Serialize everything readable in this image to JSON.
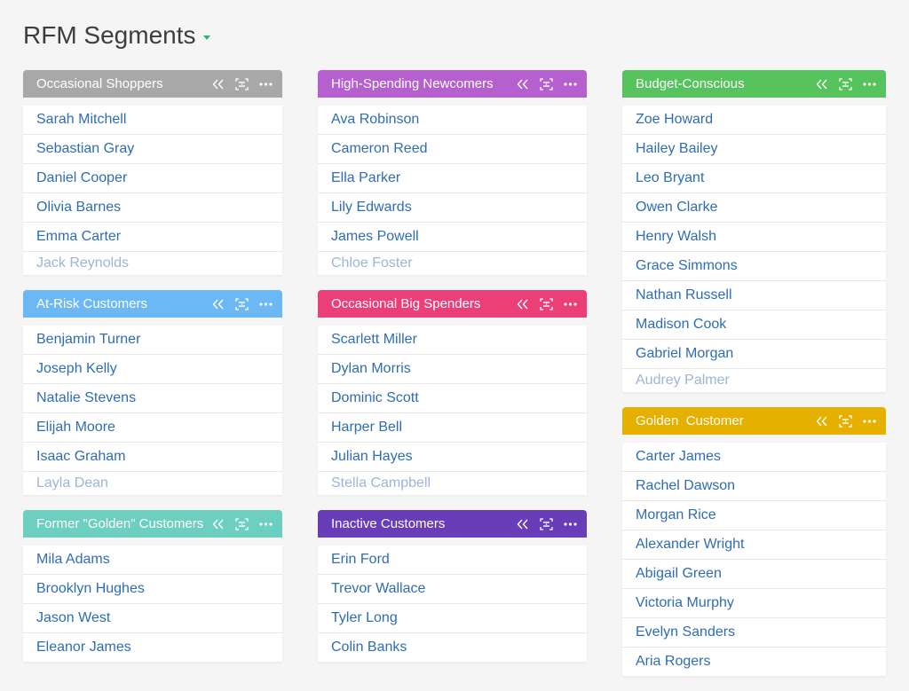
{
  "page": {
    "title": "RFM Segments"
  },
  "colors": {
    "occasional_shoppers": "#a8a8a8",
    "at_risk": "#6cb8f5",
    "former_golden": "#6ccfbf",
    "high_spending_newcomers": "#b660cf",
    "occasional_big_spenders": "#ec3f78",
    "inactive": "#6a3db8",
    "budget_conscious": "#56c35c",
    "golden": "#e5b000",
    "card_text": "#2e6db4"
  },
  "icons": {
    "collapse": "double-chevron-left-icon",
    "select": "select-all-icon",
    "more": "more-horizontal-icon"
  },
  "groups": {
    "occasional_shoppers": {
      "title": "Occasional Shoppers",
      "members": [
        "Sarah Mitchell",
        "Sebastian Gray",
        "Daniel Cooper",
        "Olivia Barnes",
        "Emma Carter",
        "Jack Reynolds"
      ]
    },
    "at_risk": {
      "title": "At-Risk Customers",
      "members": [
        "Benjamin Turner",
        "Joseph Kelly",
        "Natalie Stevens",
        "Elijah Moore",
        "Isaac Graham",
        "Layla Dean"
      ]
    },
    "former_golden": {
      "title": "Former \"Golden\" Customers",
      "members": [
        "Mila Adams",
        "Brooklyn Hughes",
        "Jason West",
        "Eleanor James"
      ]
    },
    "high_spending_newcomers": {
      "title": "High-Spending Newcomers",
      "members": [
        "Ava Robinson",
        "Cameron Reed",
        "Ella Parker",
        "Lily Edwards",
        "James Powell",
        "Chloe Foster"
      ]
    },
    "occasional_big_spenders": {
      "title": "Occasional Big Spenders",
      "members": [
        "Scarlett Miller",
        "Dylan Morris",
        "Dominic Scott",
        "Harper Bell",
        "Julian Hayes",
        "Stella Campbell"
      ]
    },
    "inactive": {
      "title": "Inactive Customers",
      "members": [
        "Erin Ford",
        "Trevor Wallace",
        "Tyler Long",
        "Colin Banks"
      ]
    },
    "budget_conscious": {
      "title": "Budget-Conscious",
      "members": [
        "Zoe Howard",
        "Hailey Bailey",
        "Leo Bryant",
        "Owen Clarke",
        "Henry Walsh",
        "Grace Simmons",
        "Nathan Russell",
        "Madison Cook",
        "Gabriel Morgan",
        "Audrey Palmer"
      ]
    },
    "golden": {
      "title": "Golden  Customer",
      "members": [
        "Carter James",
        "Rachel Dawson",
        "Morgan Rice",
        "Alexander Wright",
        "Abigail Green",
        "Victoria Murphy",
        "Evelyn Sanders",
        "Aria Rogers"
      ]
    }
  }
}
